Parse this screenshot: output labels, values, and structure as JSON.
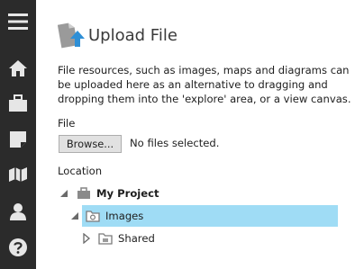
{
  "sidebar": {
    "items": [
      {
        "icon": "menu-icon"
      },
      {
        "icon": "home-icon"
      },
      {
        "icon": "briefcase-icon"
      },
      {
        "icon": "note-icon"
      },
      {
        "icon": "map-icon"
      },
      {
        "icon": "user-icon"
      },
      {
        "icon": "help-icon"
      }
    ]
  },
  "dialog": {
    "title": "Upload File",
    "description": "File resources, such as images, maps and diagrams can be uploaded here as an alternative to dragging and dropping them into the 'explore' area, or a view canvas.",
    "file_label": "File",
    "browse_label": "Browse...",
    "no_files_text": "No files selected.",
    "location_label": "Location"
  },
  "tree": {
    "project": "My Project",
    "images": "Images",
    "shared": "Shared"
  },
  "colors": {
    "sidebar_bg": "#2b2b2b",
    "sidebar_icon": "#e6e6e6",
    "accent": "#2e8fd6",
    "selected_row": "#9fdcf5"
  }
}
